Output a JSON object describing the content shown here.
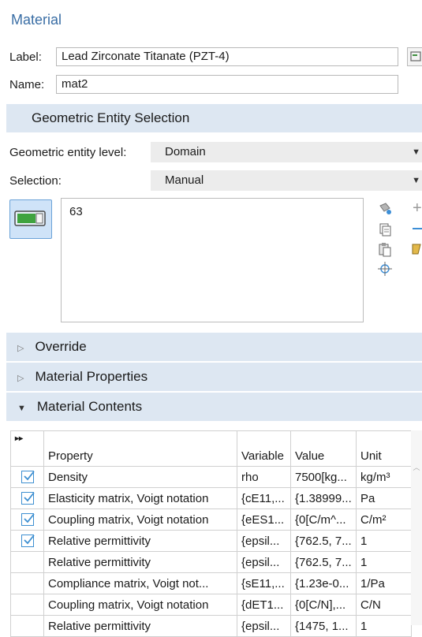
{
  "title": "Material",
  "label_caption": "Label:",
  "label_value": "Lead Zirconate Titanate (PZT-4)",
  "name_caption": "Name:",
  "name_value": "mat2",
  "geo_section": "Geometric Entity Selection",
  "geo_level_caption": "Geometric entity level:",
  "geo_level_value": "Domain",
  "selection_caption": "Selection:",
  "selection_value": "Manual",
  "selection_list": [
    "63"
  ],
  "override_section": "Override",
  "mat_props_section": "Material Properties",
  "mat_contents_section": "Material Contents",
  "table": {
    "expand_glyph": "▸▸",
    "headers": [
      "Property",
      "Variable",
      "Value",
      "Unit"
    ],
    "rows": [
      {
        "checked": true,
        "property": "Density",
        "variable": "rho",
        "value": "7500[kg...",
        "unit": "kg/m³"
      },
      {
        "checked": true,
        "property": "Elasticity matrix, Voigt notation",
        "variable": "{cE11,...",
        "value": "{1.38999...",
        "unit": "Pa"
      },
      {
        "checked": true,
        "property": "Coupling matrix, Voigt notation",
        "variable": "{eES1...",
        "value": "{0[C/m^...",
        "unit": "C/m²"
      },
      {
        "checked": true,
        "property": "Relative permittivity",
        "variable": "{epsil...",
        "value": "{762.5, 7...",
        "unit": "1"
      },
      {
        "checked": false,
        "property": "Relative permittivity",
        "variable": "{epsil...",
        "value": "{762.5, 7...",
        "unit": "1"
      },
      {
        "checked": false,
        "property": "Compliance matrix, Voigt not...",
        "variable": "{sE11,...",
        "value": "{1.23e-0...",
        "unit": "1/Pa"
      },
      {
        "checked": false,
        "property": "Coupling matrix, Voigt notation",
        "variable": "{dET1...",
        "value": "{0[C/N],...",
        "unit": "C/N"
      },
      {
        "checked": false,
        "property": "Relative permittivity",
        "variable": "{epsil...",
        "value": "{1475, 1...",
        "unit": "1"
      }
    ]
  },
  "icons": [
    "paint-bucket-icon",
    "copy-icon",
    "paste-icon",
    "zoom-selection-icon",
    "add-icon",
    "remove-icon",
    "clear-icon",
    "toggle-selection-icon",
    "label-tag-icon"
  ],
  "accent_color": "#3a6ea5"
}
